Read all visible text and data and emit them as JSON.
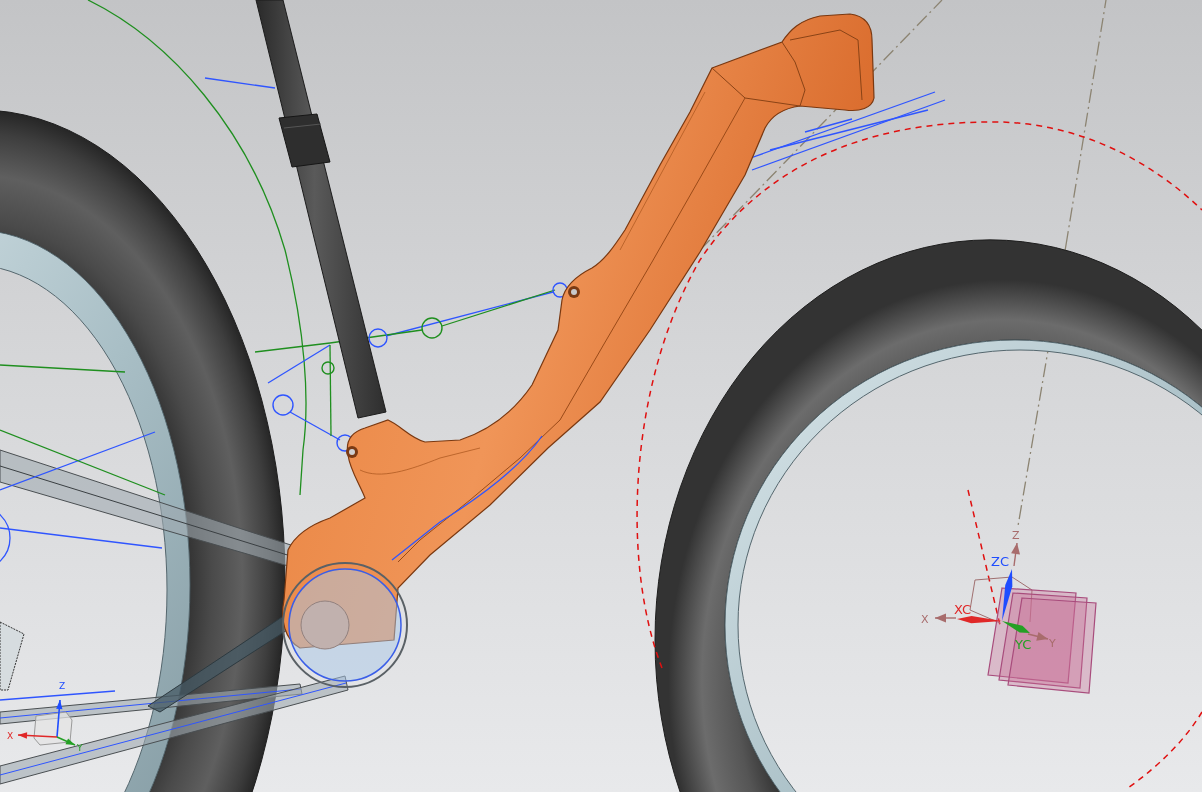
{
  "viewport": {
    "triads": [
      {
        "kind": "absolute",
        "axes": [
          {
            "kind": "z",
            "label": "Z",
            "color": "#a86c6c"
          },
          {
            "kind": "x",
            "label": "X",
            "color": "#a86c6c"
          },
          {
            "kind": "y",
            "label": "Y",
            "color": "#a86c6c"
          }
        ]
      },
      {
        "kind": "wcs",
        "axes": [
          {
            "kind": "z",
            "label": "ZC",
            "color": "#1f4dff"
          },
          {
            "kind": "x",
            "label": "XC",
            "color": "#e02828"
          },
          {
            "kind": "y",
            "label": "YC",
            "color": "#24a024"
          }
        ]
      },
      {
        "kind": "mini",
        "axes": [
          {
            "kind": "z",
            "label": "Z",
            "color": "#1f4dff"
          },
          {
            "kind": "x",
            "label": "X",
            "color": "#e02828"
          },
          {
            "kind": "y",
            "label": "Y",
            "color": "#24a024"
          }
        ]
      }
    ]
  }
}
